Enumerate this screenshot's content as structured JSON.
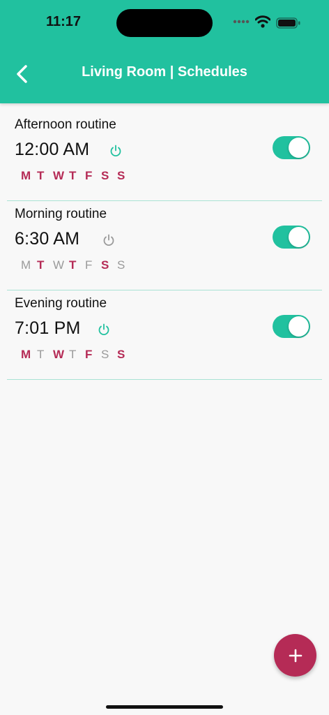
{
  "status_bar": {
    "time": "11:17"
  },
  "header": {
    "title": "Living Room | Schedules"
  },
  "colors": {
    "accent": "#21c19f",
    "day_on": "#b52b56",
    "day_off": "#9a9a9a",
    "fab": "#b52b56"
  },
  "schedules": [
    {
      "name": "Afternoon routine",
      "time": "12:00 AM",
      "power": "on",
      "enabled": true,
      "days": [
        {
          "label": "M",
          "on": true
        },
        {
          "label": "T",
          "on": true
        },
        {
          "label": "W",
          "on": true
        },
        {
          "label": "T",
          "on": true
        },
        {
          "label": "F",
          "on": true
        },
        {
          "label": "S",
          "on": true
        },
        {
          "label": "S",
          "on": true
        }
      ]
    },
    {
      "name": "Morning routine",
      "time": "6:30 AM",
      "power": "off",
      "enabled": true,
      "days": [
        {
          "label": "M",
          "on": false
        },
        {
          "label": "T",
          "on": true
        },
        {
          "label": "W",
          "on": false
        },
        {
          "label": "T",
          "on": true
        },
        {
          "label": "F",
          "on": false
        },
        {
          "label": "S",
          "on": true
        },
        {
          "label": "S",
          "on": false
        }
      ]
    },
    {
      "name": "Evening routine",
      "time": "7:01 PM",
      "power": "on",
      "enabled": true,
      "days": [
        {
          "label": "M",
          "on": true
        },
        {
          "label": "T",
          "on": false
        },
        {
          "label": "W",
          "on": true
        },
        {
          "label": "T",
          "on": false
        },
        {
          "label": "F",
          "on": true
        },
        {
          "label": "S",
          "on": false
        },
        {
          "label": "S",
          "on": true
        }
      ]
    }
  ],
  "fab": {
    "icon": "plus-icon"
  }
}
